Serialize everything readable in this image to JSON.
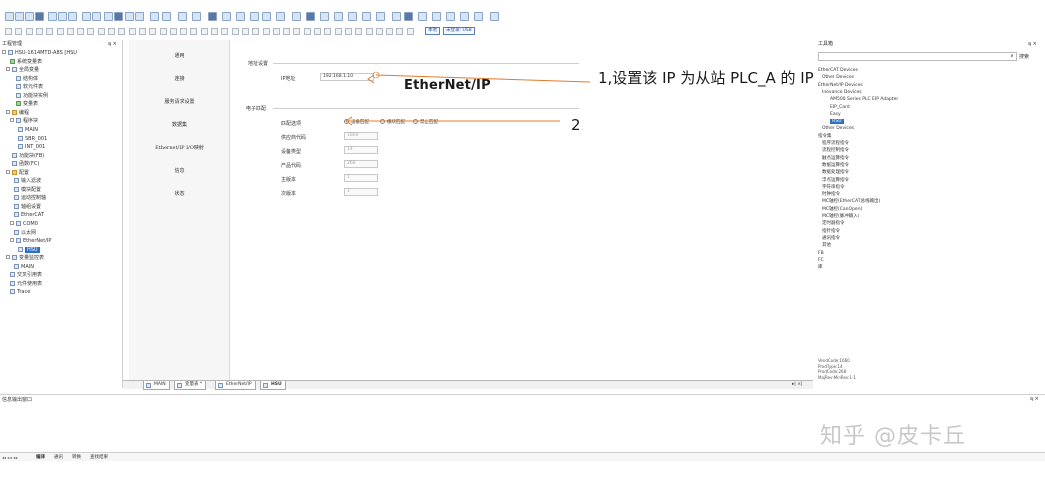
{
  "toolbar": {
    "labels": {
      "local": "本地",
      "not_logged": "未登录: USB"
    }
  },
  "left_panel": {
    "title": "工程管理",
    "pin": "ą ×",
    "items": [
      "HSU-1614MTD-A8S [HSU",
      "系统变量表",
      "全局变量",
      "结构体",
      "软元件表",
      "功能块实例",
      "变量表",
      "编程",
      "程序块",
      "MAIN",
      "SBR_001",
      "INT_001",
      "功能块(FB)",
      "函数(FC)",
      "配置",
      "输入滤波",
      "模块配置",
      "运动控制轴",
      "轴组设置",
      "EtherCAT",
      "COM0",
      "以太网",
      "EtherNet/IP",
      "HSU",
      "变量监控表",
      "MAIN",
      "交叉引用表",
      "元件使用表",
      "Trace"
    ]
  },
  "nav": {
    "items": [
      "通用",
      "连接",
      "服务请求设置",
      "数据集",
      "Ethernet/IP I/O映射",
      "信息",
      "状态"
    ]
  },
  "content": {
    "addr_section": "地址设置",
    "ip_label": "IP地址",
    "ip_value": "192.168.1.10",
    "logo": "EtherNet/IP",
    "elec_section": "电子匹配",
    "match_label": "匹配选项",
    "radio_1": "设备匹配",
    "radio_2": "模块匹配",
    "radio_3": "禁止匹配",
    "vendor_label": "供应商代码",
    "vendor_value": "1660",
    "devtype_label": "设备类型",
    "devtype_value": "14",
    "prodcode_label": "产品代码",
    "prodcode_value": "268",
    "major_label": "主版本",
    "major_value": "1",
    "minor_label": "次版本",
    "minor_value": "1"
  },
  "annotations": {
    "note1": "1,设置该 IP 为从站 PLC_A 的 IP",
    "note2": "2"
  },
  "right_panel": {
    "title": "工具箱",
    "pin": "ą ×",
    "search_label": "搜索",
    "items": [
      "EtherCAT Devices",
      "Other Devices",
      "EtherNet/IP Devices",
      "Inovance Devices",
      "AM500 Series PLC EIP Adapter",
      "EIP_Card",
      "Easy",
      "HSU",
      "Other Devices",
      "指令集",
      "程序流程指令",
      "流程控制指令",
      "触点运算指令",
      "数据运算指令",
      "数据处理指令",
      "浮点运算指令",
      "字符串指令",
      "时钟指令",
      "MC轴控(EtherCAT总线输出)",
      "MC轴控(CanOpen)",
      "MC轴控(脉冲输入)",
      "定时器指令",
      "指针指令",
      "通讯指令",
      "其他",
      "FB",
      "FC",
      "库"
    ],
    "info": [
      "VendCode:1660",
      "ProdType:14",
      "ProdCode:268",
      "MajRev-MinRev:1-1"
    ]
  },
  "tabs": [
    "MAIN",
    "变量表 *",
    "EtherNet/IP",
    "HSU"
  ],
  "tab_close": "▸| ×|",
  "output": {
    "title": "信息输出窗口",
    "pin": "ą ×"
  },
  "bottom_tabs": [
    "编译",
    "通讯",
    "转换",
    "查找结果"
  ],
  "watermark": "知乎 @皮卡丘"
}
